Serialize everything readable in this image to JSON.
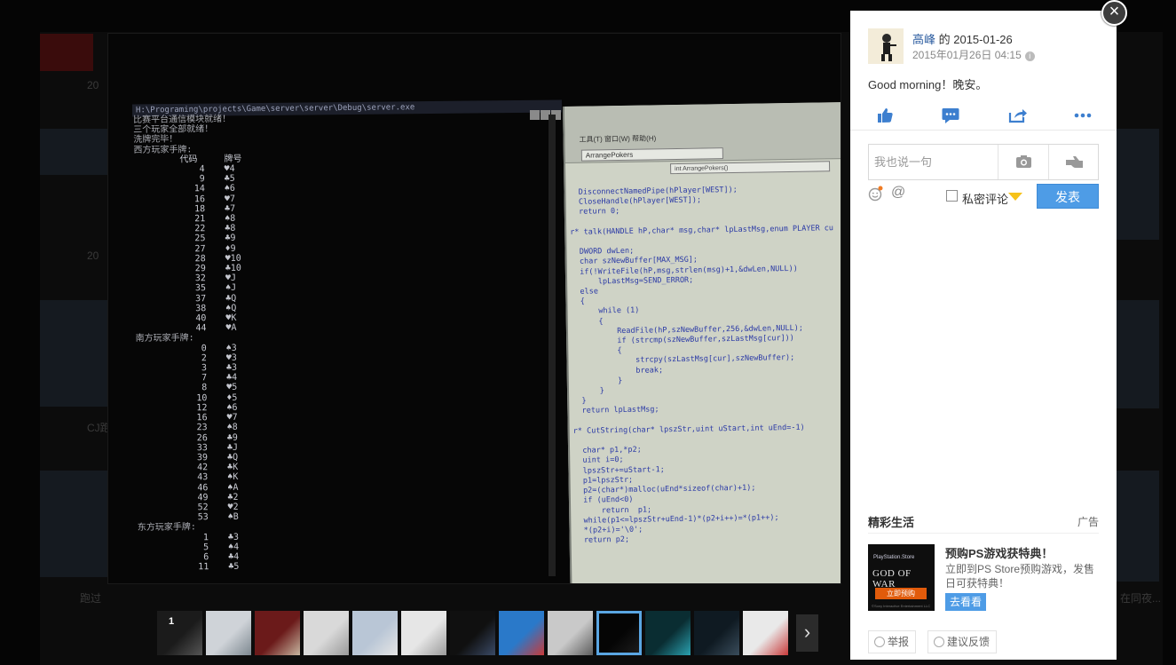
{
  "panel": {
    "author_name": "高峰",
    "author_suffix": " 的 2015-01-26",
    "timestamp": "2015年01月26日 04:15",
    "info_icon": "i",
    "post_text": "Good morning！晚安。",
    "actions": [
      "like-icon",
      "comment-icon",
      "share-icon",
      "more-icon"
    ],
    "comment_placeholder": "我也说一句",
    "private_label": "私密评论",
    "submit_label": "发表",
    "section_title": "精彩生活",
    "ad_label": "广告",
    "ad": {
      "title": "预购PS游戏获特典！",
      "description": "立即到PS Store预购游戏，发售日可获特典！",
      "button": "去看看",
      "image_store": "PlayStation.Store",
      "image_title": "GOD OF WAR",
      "image_button": "立即预购",
      "image_fine": "©Sony Interactive Entertainment LLC"
    },
    "report_label": "举报",
    "feedback_label": "建议反馈",
    "close_glyph": "×"
  },
  "background": {
    "dates": [
      "20",
      "20",
      "20",
      "CJ跑",
      "跑过",
      "在同夜..."
    ]
  },
  "photo": {
    "console_title": "H:\\Programing\\projects\\Game\\server\\server\\Debug\\server.exe",
    "console_lines": [
      "比赛平台通信模块就绪！",
      "三个玩家全部就绪！",
      "洗牌完毕！",
      "西方玩家手牌:"
    ],
    "console_header": {
      "c1": "代码",
      "c2": "牌号"
    },
    "west_rows": [
      [
        "4",
        "♥4"
      ],
      [
        "9",
        "♣5"
      ],
      [
        "14",
        "♠6"
      ],
      [
        "16",
        "♥7"
      ],
      [
        "18",
        "♣7"
      ],
      [
        "21",
        "♠8"
      ],
      [
        "22",
        "♣8"
      ],
      [
        "25",
        "♣9"
      ],
      [
        "27",
        "♦9"
      ],
      [
        "28",
        "♥10"
      ],
      [
        "29",
        "♣10"
      ],
      [
        "32",
        "♥J"
      ],
      [
        "35",
        "♠J"
      ],
      [
        "37",
        "♣Q"
      ],
      [
        "38",
        "♠Q"
      ],
      [
        "40",
        "♥K"
      ],
      [
        "44",
        "♥A"
      ]
    ],
    "south_label": "南方玩家手牌:",
    "south_rows": [
      [
        "0",
        "♠3"
      ],
      [
        "2",
        "♥3"
      ],
      [
        "3",
        "♣3"
      ],
      [
        "7",
        "♣4"
      ],
      [
        "8",
        "♥5"
      ],
      [
        "10",
        "♦5"
      ],
      [
        "12",
        "♠6"
      ],
      [
        "16",
        "♥7"
      ],
      [
        "23",
        "♠8"
      ],
      [
        "26",
        "♣9"
      ],
      [
        "33",
        "♣J"
      ],
      [
        "39",
        "♣Q"
      ],
      [
        "42",
        "♣K"
      ],
      [
        "43",
        "♠K"
      ],
      [
        "46",
        "♠A"
      ],
      [
        "49",
        "♣2"
      ],
      [
        "52",
        "♥2"
      ],
      [
        "53",
        "♠B"
      ]
    ],
    "east_label": "东方玩家手牌:",
    "east_rows": [
      [
        "1",
        "♣3"
      ],
      [
        "5",
        "♠4"
      ],
      [
        "6",
        "♣4"
      ],
      [
        "11",
        "♣5"
      ]
    ],
    "ide_menu": "工具(T)  窗口(W)  帮助(H)",
    "ide_combo": "ArrangePokers",
    "ide_combo2": "int ArrangePokers()",
    "ide_code": [
      "  DisconnectNamedPipe(hPlayer[WEST]);",
      "  CloseHandle(hPlayer[WEST]);",
      "  return 0;",
      "",
      "r* talk(HANDLE hP,char* msg,char* lpLastMsg,enum PLAYER cu",
      "",
      "  DWORD dwLen;",
      "  char szNewBuffer[MAX_MSG];",
      "  if(!WriteFile(hP,msg,strlen(msg)+1,&dwLen,NULL))",
      "      lpLastMsg=SEND_ERROR;",
      "  else",
      "  {",
      "      while (1)",
      "      {",
      "          ReadFile(hP,szNewBuffer,256,&dwLen,NULL);",
      "          if (strcmp(szNewBuffer,szLastMsg[cur]))",
      "          {",
      "              strcpy(szLastMsg[cur],szNewBuffer);",
      "              break;",
      "          }",
      "      }",
      "  }",
      "  return lpLastMsg;",
      "",
      "r* CutString(char* lpszStr,uint uStart,int uEnd=-1)",
      "",
      "  char* p1,*p2;",
      "  uint i=0;",
      "  lpszStr+=uStart-1;",
      "  p1=lpszStr;",
      "  p2=(char*)malloc(uEnd*sizeof(char)+1);",
      "  if (uEnd<0)",
      "      return  p1;",
      "  while(p1<=lpszStr+uEnd-1)*(p2+i++)=*(p1++);",
      "  *(p2+i)='\\0';",
      "  return p2;"
    ]
  },
  "thumbnails": {
    "count_label": "1",
    "items": [
      "thumb-1",
      "thumb-2",
      "thumb-3",
      "thumb-4",
      "thumb-5",
      "thumb-6",
      "thumb-7",
      "thumb-8",
      "thumb-9",
      "thumb-10",
      "thumb-11",
      "thumb-12",
      "thumb-13"
    ],
    "active_index": 9
  },
  "colors": {
    "accent": "#4e9ce6",
    "link": "#2a5b9f",
    "active_thumb": "#5aa6e3"
  }
}
